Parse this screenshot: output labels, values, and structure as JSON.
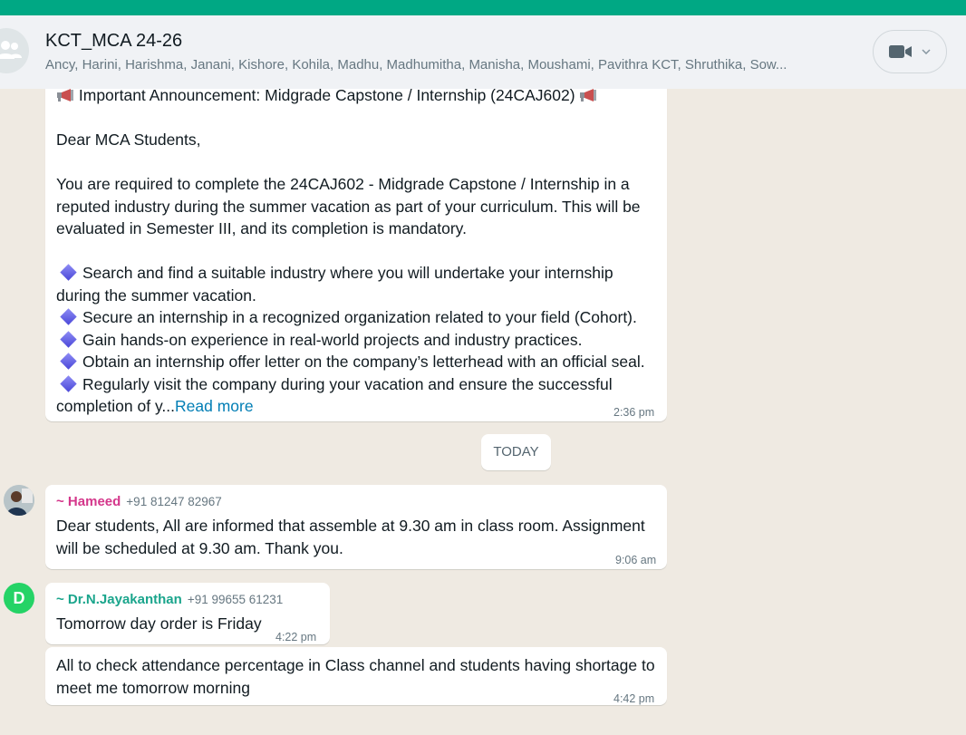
{
  "header": {
    "group_name": "KCT_MCA 24-26",
    "members": "Ancy, Harini, Harishma, Janani, Kishore, Kohila, Madhu, Madhumitha, Manisha, Moushami,  Pavithra KCT, Shruthika, Sow..."
  },
  "messages": {
    "announcement": {
      "title": "Important Announcement: Midgrade Capstone / Internship (24CAJ602)",
      "greeting": "Dear MCA Students,",
      "para1_line1": "You are required to complete the 24CAJ602 - Midgrade Capstone / Internship in a",
      "para1_line2": "reputed industry during the summer vacation as part of your curriculum. This will be",
      "para1_line3": "evaluated in Semester III, and its completion is mandatory.",
      "bullet1_line1": "Search and find a suitable industry where you will undertake your internship",
      "bullet1_line2": "during the summer vacation.",
      "bullet2": "Secure an internship in a recognized organization related to your field (Cohort).",
      "bullet3": "Gain hands-on experience in real-world projects and industry practices.",
      "bullet4": "Obtain an internship offer letter on the company’s letterhead with an official seal.",
      "bullet5_line1": "Regularly visit the company during your vacation and ensure the successful",
      "bullet5_line2": "completion of y...",
      "read_more": "Read more",
      "time": "2:36 pm"
    },
    "date_divider": "TODAY",
    "hameed": {
      "sender": "~ Hameed",
      "phone": "+91 81247 82967",
      "line1": "Dear students,  All are informed that assemble at 9.30 am in class room. Assignment",
      "line2": "will be scheduled at 9.30 am. Thank you.",
      "time": "9:06 am"
    },
    "jayakanthan": {
      "avatar_letter": "D",
      "sender": "~ Dr.N.Jayakanthan",
      "phone": "+91 99655 61231",
      "text": "Tomorrow  day order is Friday",
      "time": "4:22 pm"
    },
    "attendance": {
      "line1": "All to check attendance percentage in Class channel and students having shortage to",
      "line2": "meet me tomorrow morning",
      "time": "4:42 pm"
    }
  },
  "icons": {
    "group_avatar": "group-icon",
    "video": "video-camera-icon",
    "dropdown": "chevron-down-icon",
    "megaphone": "megaphone-icon",
    "bullet": "blue-diamond-icon"
  },
  "colors": {
    "accent": "#00a884",
    "chat_bg": "#efeae2",
    "header_bg": "#f0f2f5",
    "link": "#027eb5",
    "sender_hameed": "#d4378b",
    "sender_jayakanthan": "#1aa58c"
  }
}
